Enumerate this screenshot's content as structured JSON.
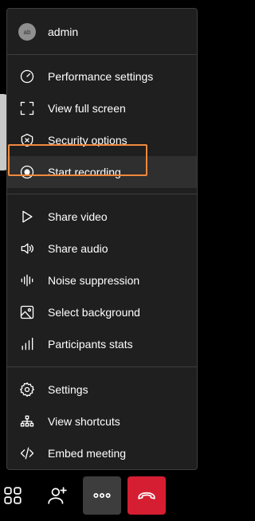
{
  "user": {
    "name": "admin",
    "avatar_initials": "ab"
  },
  "menu": {
    "groups": [
      [
        {
          "label": "Performance settings",
          "icon": "gauge-icon"
        },
        {
          "label": "View full screen",
          "icon": "fullscreen-icon"
        },
        {
          "label": "Security options",
          "icon": "shield-icon"
        },
        {
          "label": "Start recording",
          "icon": "record-icon"
        }
      ],
      [
        {
          "label": "Share video",
          "icon": "play-icon"
        },
        {
          "label": "Share audio",
          "icon": "speaker-icon"
        },
        {
          "label": "Noise suppression",
          "icon": "waveform-icon"
        },
        {
          "label": "Select background",
          "icon": "image-icon"
        },
        {
          "label": "Participants stats",
          "icon": "bar-chart-icon"
        }
      ],
      [
        {
          "label": "Settings",
          "icon": "gear-icon"
        },
        {
          "label": "View shortcuts",
          "icon": "hierarchy-icon"
        },
        {
          "label": "Embed meeting",
          "icon": "code-icon"
        }
      ]
    ]
  },
  "toolbar": {
    "buttons": [
      {
        "name": "tile-view",
        "icon": "grid-icon"
      },
      {
        "name": "invite",
        "icon": "add-person-icon"
      },
      {
        "name": "more-actions",
        "icon": "more-dots-icon"
      },
      {
        "name": "leave-meeting",
        "icon": "hangup-icon"
      }
    ]
  },
  "colors": {
    "highlight": "#f0883e",
    "hangup": "#d51e31",
    "menu_bg": "#1f1f1f"
  }
}
